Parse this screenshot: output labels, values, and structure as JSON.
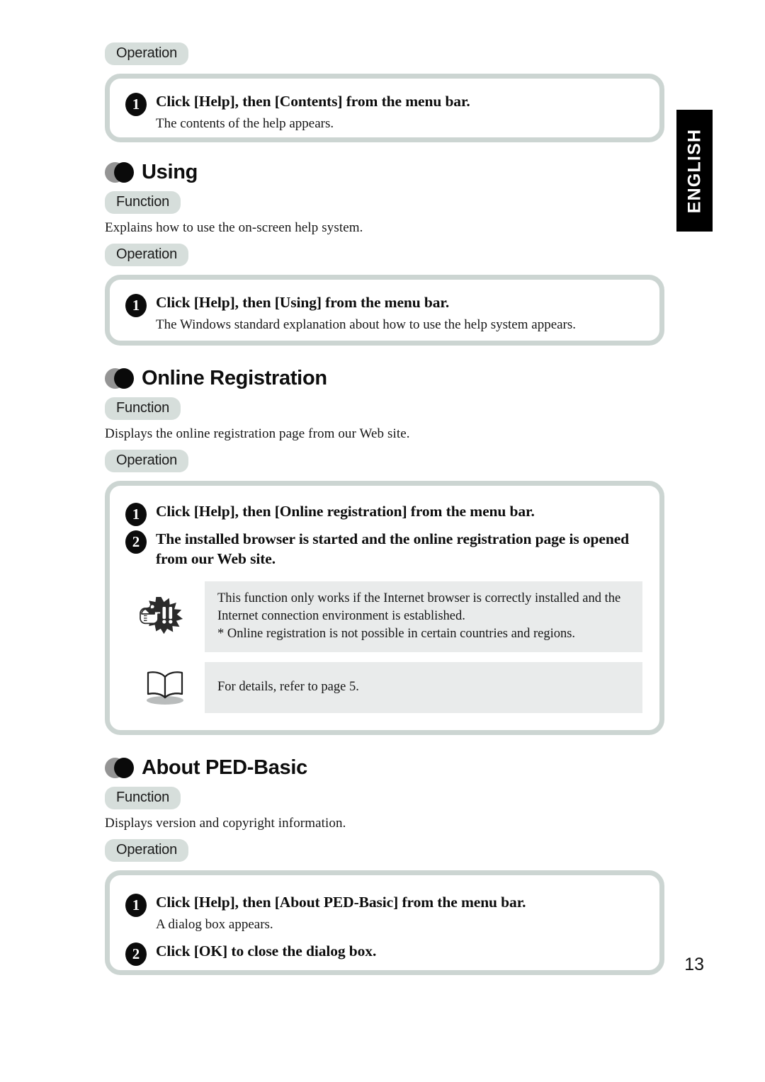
{
  "page": {
    "number": "13",
    "language_tab": "ENGLISH",
    "labels": {
      "function": "Function",
      "operation": "Operation"
    }
  },
  "top_section": {
    "operation_label": "Operation",
    "steps": [
      {
        "num": "1",
        "title": "Click [Help], then [Contents] from the menu bar.",
        "note": "The contents of the help appears."
      }
    ]
  },
  "sections": [
    {
      "id": "using",
      "title": "Using",
      "function_label": "Function",
      "function_text": "Explains how to use the on-screen help system.",
      "operation_label": "Operation",
      "steps": [
        {
          "num": "1",
          "title": "Click [Help], then [Using] from the menu bar.",
          "note": "The Windows standard explanation about how to use the help system appears."
        }
      ]
    },
    {
      "id": "online-registration",
      "title": "Online Registration",
      "function_label": "Function",
      "function_text": "Displays the online registration page from our Web site.",
      "operation_label": "Operation",
      "steps": [
        {
          "num": "1",
          "title": "Click [Help], then [Online registration] from the menu bar.",
          "note": ""
        },
        {
          "num": "2",
          "title": "The installed browser is started and the online registration page is opened from our Web site.",
          "note": ""
        }
      ],
      "notes": [
        {
          "icon": "caution-icon",
          "line1": "This function only works if the Internet browser is correctly installed and the Internet connection environment is established.",
          "line2": "* Online registration is not possible in certain countries and regions."
        },
        {
          "icon": "book-icon",
          "line1": "For details, refer to page 5.",
          "line2": ""
        }
      ]
    },
    {
      "id": "about-ped-basic",
      "title": "About PED-Basic",
      "function_label": "Function",
      "function_text": "Displays version and copyright information.",
      "operation_label": "Operation",
      "steps": [
        {
          "num": "1",
          "title": "Click [Help], then [About PED-Basic] from the menu bar.",
          "note": "A dialog box appears."
        },
        {
          "num": "2",
          "title": "Click [OK] to close the dialog box.",
          "note": ""
        }
      ]
    }
  ],
  "colors": {
    "pill_bg": "#d6dedb",
    "box_border": "#ccd5d2",
    "note_bg": "#e9ebeb",
    "tab_bg": "#000000",
    "bullet_gray": "#949494",
    "bullet_black": "#0a0a0a"
  }
}
